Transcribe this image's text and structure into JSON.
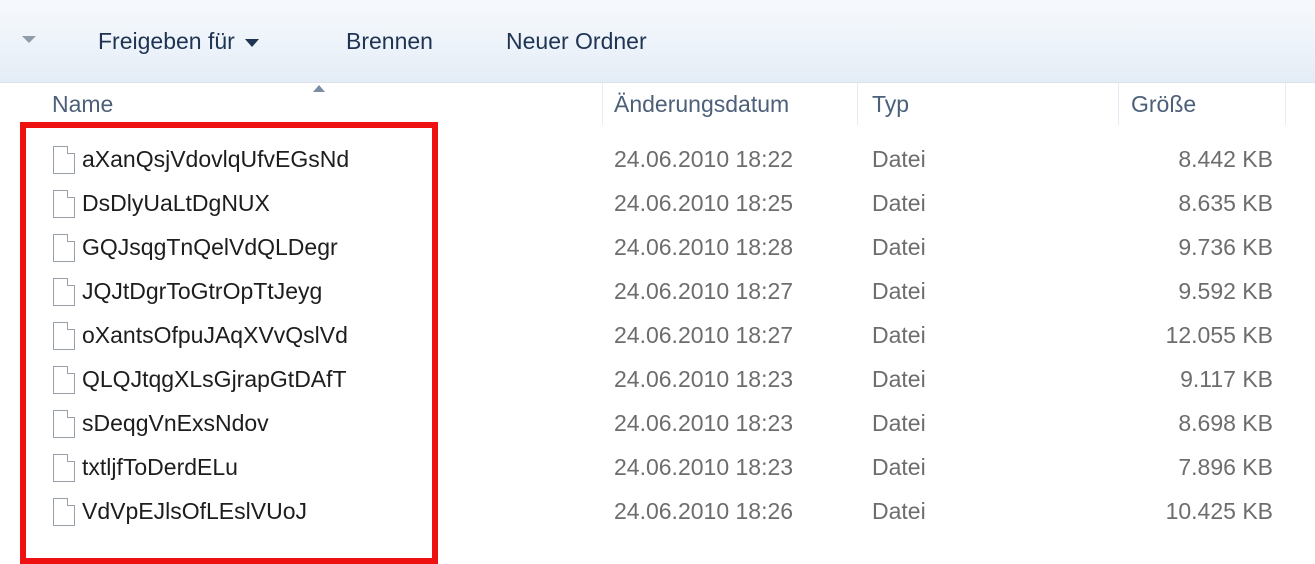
{
  "toolbar": {
    "share_label": "Freigeben für",
    "burn_label": "Brennen",
    "new_folder_label": "Neuer Ordner"
  },
  "columns": {
    "name": "Name",
    "date": "Änderungsdatum",
    "type": "Typ",
    "size": "Größe"
  },
  "files": [
    {
      "name": "aXanQsjVdovlqUfvEGsNd",
      "date": "24.06.2010 18:22",
      "type": "Datei",
      "size": "8.442 KB"
    },
    {
      "name": "DsDlyUaLtDgNUX",
      "date": "24.06.2010 18:25",
      "type": "Datei",
      "size": "8.635 KB"
    },
    {
      "name": "GQJsqgTnQelVdQLDegr",
      "date": "24.06.2010 18:28",
      "type": "Datei",
      "size": "9.736 KB"
    },
    {
      "name": "JQJtDgrToGtrOpTtJeyg",
      "date": "24.06.2010 18:27",
      "type": "Datei",
      "size": "9.592 KB"
    },
    {
      "name": "oXantsOfpuJAqXVvQslVd",
      "date": "24.06.2010 18:27",
      "type": "Datei",
      "size": "12.055 KB"
    },
    {
      "name": "QLQJtqgXLsGjrapGtDAfT",
      "date": "24.06.2010 18:23",
      "type": "Datei",
      "size": "9.117 KB"
    },
    {
      "name": "sDeqgVnExsNdov",
      "date": "24.06.2010 18:23",
      "type": "Datei",
      "size": "8.698 KB"
    },
    {
      "name": "txtljfToDerdELu",
      "date": "24.06.2010 18:23",
      "type": "Datei",
      "size": "7.896 KB"
    },
    {
      "name": "VdVpEJlsOfLEslVUoJ",
      "date": "24.06.2010 18:26",
      "type": "Datei",
      "size": "10.425 KB"
    }
  ],
  "colors": {
    "highlight": "#ee1111",
    "toolbar_text": "#1e3452"
  }
}
